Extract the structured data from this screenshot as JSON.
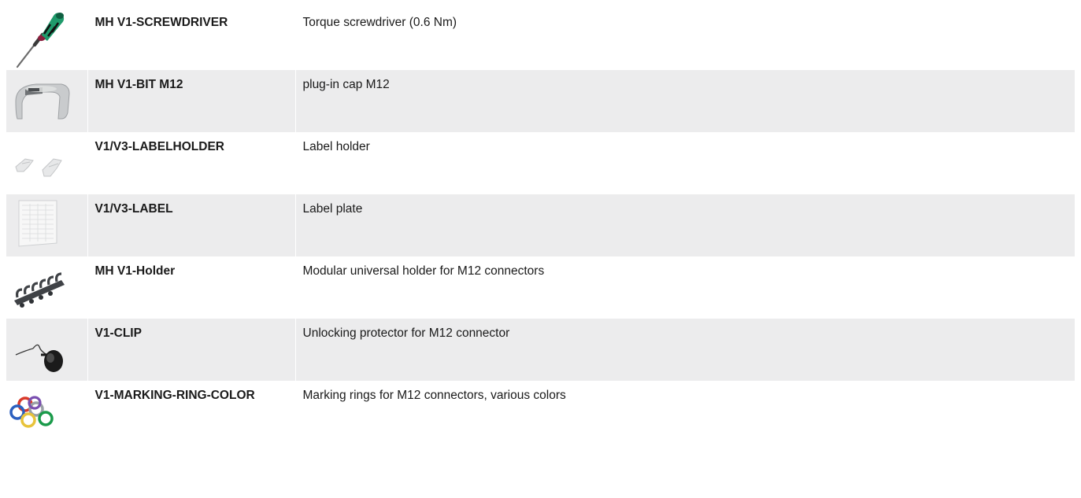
{
  "accessories": [
    {
      "icon": "screwdriver-image",
      "code": "MH V1-SCREWDRIVER",
      "description": "Torque screwdriver (0.6 Nm)"
    },
    {
      "icon": "plug-in-cap-image",
      "code": "MH V1-BIT M12",
      "description": "plug-in cap M12"
    },
    {
      "icon": "label-holder-image",
      "code": "V1/V3-LABELHOLDER",
      "description": "Label holder"
    },
    {
      "icon": "label-plate-image",
      "code": "V1/V3-LABEL",
      "description": "Label plate"
    },
    {
      "icon": "modular-holder-image",
      "code": "MH V1-Holder",
      "description": "Modular universal holder for M12 connectors"
    },
    {
      "icon": "unlocking-clip-image",
      "code": "V1-CLIP",
      "description": "Unlocking protector for M12 connector"
    },
    {
      "icon": "marking-rings-image",
      "code": "V1-MARKING-RING-COLOR",
      "description": "Marking rings for M12 connectors, various colors"
    }
  ],
  "colors": {
    "row_shade": "#ececed",
    "screwdriver_handle": "#1f9a6b",
    "ring_colors": [
      "#d93a2a",
      "#2a5fbf",
      "#9aa0a6",
      "#e8c33a",
      "#1a9a4a",
      "#7a4fb0"
    ]
  }
}
